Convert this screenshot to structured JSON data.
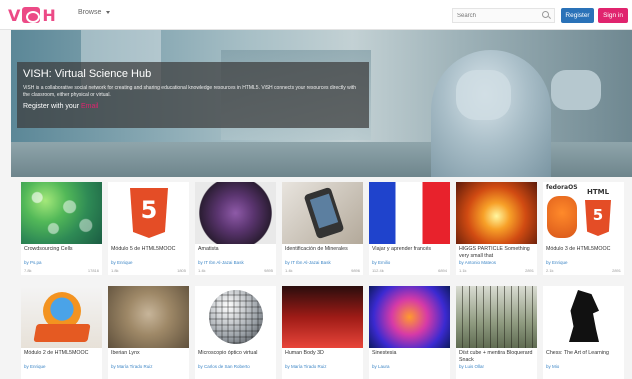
{
  "header": {
    "logo_text": "ViSH",
    "browse_label": "Browse",
    "search_placeholder": "Search",
    "register_label": "Register",
    "signin_label": "Sign in"
  },
  "hero": {
    "title": "VISH: Virtual Science Hub",
    "description": "ViSH is a collaborative social network for creating and sharing educational knowledge resources in HTML5. ViSH connects your resources directly with the classroom, either physical or virtual.",
    "cta_prefix": "Register with your",
    "cta_link": "Email"
  },
  "cards_row1": [
    {
      "title": "Crowdsourcing Cells",
      "author": "by Ps.pa",
      "views": "7.8k",
      "likes": "17816"
    },
    {
      "title": "Módulo 5 de HTML5MOOC",
      "author": "by Enrique",
      "views": "1.8k",
      "likes": "1805"
    },
    {
      "title": "Amatista",
      "author": "by IT Ibn Al-Jazai Bask",
      "views": "1.4k",
      "likes": "9895"
    },
    {
      "title": "Identificación de Minerales",
      "author": "by IT Ibn Al-Jazai Bask",
      "views": "1.4k",
      "likes": "9896"
    },
    {
      "title": "Viajar y aprender francés",
      "author": "by Emilio",
      "views": "112.4k",
      "likes": "6894"
    },
    {
      "title": "HIGGS PARTICLE Something very small that",
      "author": "by Antonio Mateos",
      "views": "1.1k",
      "likes": "2891"
    },
    {
      "title": "Módulo 3 de HTML5MOOC",
      "author": "by Enrique",
      "views": "2.1k",
      "likes": "2891"
    }
  ],
  "cards_row2": [
    {
      "title": "Módulo 2 de HTML5MOOC",
      "author": "by Enrique"
    },
    {
      "title": "Iberian Lynx",
      "author": "by María Tirado Ruiz"
    },
    {
      "title": "Microscopio óptico virtual",
      "author": "by Carlos de San Roberto"
    },
    {
      "title": "Human Body 3D",
      "author": "by María Tirado Ruiz"
    },
    {
      "title": "Sinestesia",
      "author": "by Laura"
    },
    {
      "title": "Dïst cube + mentira Bloquerard Snack",
      "author": "by Luis Ollar"
    },
    {
      "title": "Chess: The Art of Learning",
      "author": "by Mio"
    }
  ],
  "thumb_labels": {
    "shield_number": "5",
    "fedora_label": "fedoraOS",
    "html_label": "HTML"
  },
  "colors": {
    "brand_pink": "#ec4a86",
    "register_blue": "#2a72b8",
    "signin_pink": "#e0246e"
  }
}
